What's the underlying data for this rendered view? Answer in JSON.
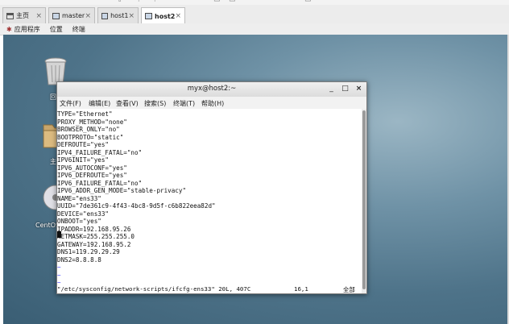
{
  "toolbar_top": {
    "glyphs": [
      "⇧",
      "⚑",
      "⚑",
      "▭",
      "▭",
      "▭"
    ]
  },
  "tabs": [
    {
      "label": "主页",
      "active": false
    },
    {
      "label": "master",
      "active": false
    },
    {
      "label": "host1",
      "active": false
    },
    {
      "label": "host2",
      "active": true
    }
  ],
  "close_glyph": "×",
  "gnome_bar": {
    "apps": "应用程序",
    "places": "位置",
    "terminal": "终端"
  },
  "desktop": {
    "icon_labels": [
      "回",
      "主",
      "CentOS"
    ]
  },
  "terminal": {
    "title": "myx@host2:~",
    "buttons": {
      "minimize": "_",
      "maximize": "□",
      "close": "×"
    },
    "menu": [
      "文件(F)",
      "编辑(E)",
      "查看(V)",
      "搜索(S)",
      "终端(T)",
      "帮助(H)"
    ],
    "lines": [
      "TYPE=\"Ethernet\"",
      "PROXY_METHOD=\"none\"",
      "BROWSER_ONLY=\"no\"",
      "BOOTPROTO=\"static\"",
      "DEFROUTE=\"yes\"",
      "IPV4_FAILURE_FATAL=\"no\"",
      "IPV6INIT=\"yes\"",
      "IPV6_AUTOCONF=\"yes\"",
      "IPV6_DEFROUTE=\"yes\"",
      "IPV6_FAILURE_FATAL=\"no\"",
      "IPV6_ADDR_GEN_MODE=\"stable-privacy\"",
      "NAME=\"ens33\"",
      "UUID=\"7de361c9-4f43-4bc8-9d5f-c6b822eea82d\"",
      "DEVICE=\"ens33\"",
      "ONBOOT=\"yes\"",
      "IPADDR=192.168.95.26",
      "NETMASK=255.255.255.0",
      "GATEWAY=192.168.95.2",
      "DNS1=119.29.29.29",
      "DNS2=8.8.8.8"
    ],
    "tilde": "~",
    "status": {
      "file": "\"/etc/sysconfig/network-scripts/ifcfg-ens33\" 20L, 407C",
      "position": "16,1",
      "scope": "全部"
    }
  }
}
